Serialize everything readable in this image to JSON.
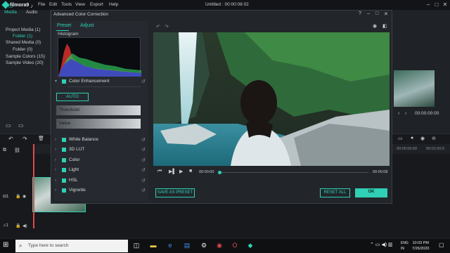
{
  "app": {
    "logo": "filmora9",
    "document_title": "Untitled : 00:00:08:02"
  },
  "menu": [
    "File",
    "Edit",
    "Tools",
    "View",
    "Export",
    "Help"
  ],
  "media_panel": {
    "tabs": [
      {
        "label": "Media",
        "icon": "folder-icon"
      },
      {
        "label": "Audio",
        "icon": "music-note-icon"
      }
    ],
    "items": [
      "Project Media (1)",
      "Folder (1)",
      "Shared Media (0)",
      "Folder (0)",
      "Sample Colors (15)",
      "Sample Video (20)"
    ]
  },
  "dialog": {
    "title": "Advanced Color Correction",
    "tabs": [
      "Preset",
      "Adjust"
    ],
    "histogram_label": "Histogram",
    "color_enhancement": "Color Enhancement",
    "auto_label": "AUTO",
    "sliders": [
      "Threshold",
      "Value"
    ],
    "sections": [
      "White Balance",
      "3D LUT",
      "Color",
      "Light",
      "HSL",
      "Vignette"
    ],
    "preview": {
      "current_time": "00:00:00",
      "end_time": "00:00:08"
    },
    "buttons": {
      "save_preset": "SAVE AS PRESET",
      "reset_all": "RESET ALL",
      "ok": "OK"
    }
  },
  "right_panel": {
    "timecode": "00:00:00:00"
  },
  "timeline": {
    "ticks": [
      "00:00:55:00",
      "00:01:00:0"
    ]
  },
  "taskbar": {
    "search_placeholder": "Type here to search",
    "lang": "ENG",
    "region": "IN",
    "time": "10:03 PM",
    "date": "7/26/2020"
  },
  "colors": {
    "accent": "#2fd0b4",
    "panel": "#22262b",
    "background": "#1b1d20"
  }
}
